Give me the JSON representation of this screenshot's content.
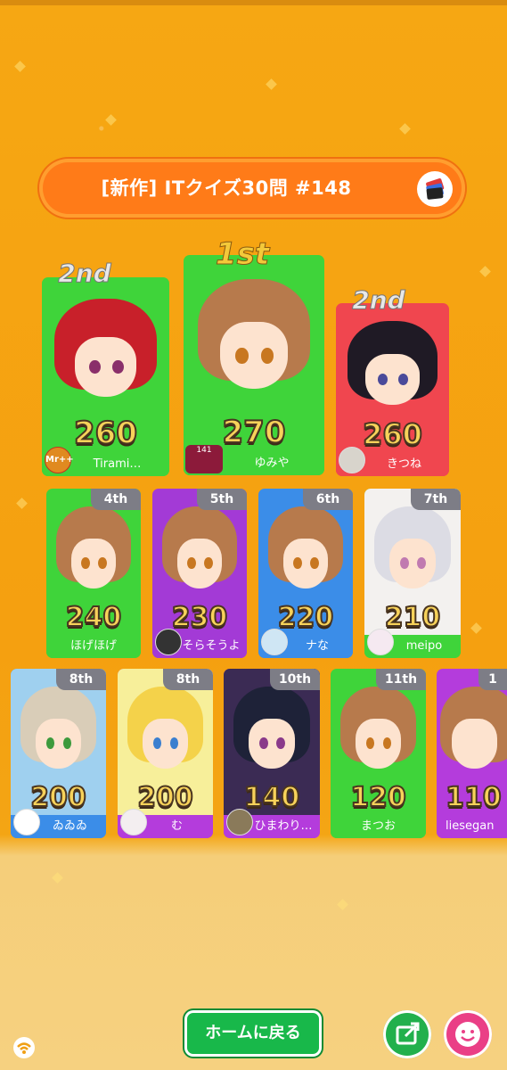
{
  "header": {
    "title": "[新作] ITクイズ30問 #148",
    "title_icon": "quiz-book-icon"
  },
  "podium": [
    {
      "rank_label": "2nd",
      "score": "260",
      "name": "Tirami…",
      "avatar_text": "Mr++",
      "color": "#3fd43a"
    },
    {
      "rank_label": "1st",
      "score": "270",
      "name": "ゆみや",
      "avatar_text": "141",
      "color": "#3fd43a"
    },
    {
      "rank_label": "2nd",
      "score": "260",
      "name": "きつね",
      "avatar_text": "",
      "color": "#f0464f"
    }
  ],
  "row2": [
    {
      "rank_label": "4th",
      "score": "240",
      "name": "ほげほげ",
      "color": "#3fd43a"
    },
    {
      "rank_label": "5th",
      "score": "230",
      "name": "そらそうよ",
      "color": "#a33ad6"
    },
    {
      "rank_label": "6th",
      "score": "220",
      "name": "ナな",
      "color": "#3b8de8"
    },
    {
      "rank_label": "7th",
      "score": "210",
      "name": "meipo",
      "color": "#3fd43a"
    }
  ],
  "row3": [
    {
      "rank_label": "8th",
      "score": "200",
      "name": "ゐゐゐ",
      "color": "#3b8de8"
    },
    {
      "rank_label": "8th",
      "score": "200",
      "name": "む",
      "color": "#b43cdc"
    },
    {
      "rank_label": "10th",
      "score": "140",
      "name": "ひまわり…",
      "color": "#b43cdc"
    },
    {
      "rank_label": "11th",
      "score": "120",
      "name": "まつお",
      "color": "#3fd43a"
    },
    {
      "rank_label": "1",
      "score": "110",
      "name": "liesegan",
      "color": "#b43cdc"
    }
  ],
  "footer": {
    "home_label": "ホームに戻る",
    "share_icon": "share-icon",
    "stamp_icon": "smile-stamp-icon",
    "connection_icon": "wifi-icon"
  }
}
